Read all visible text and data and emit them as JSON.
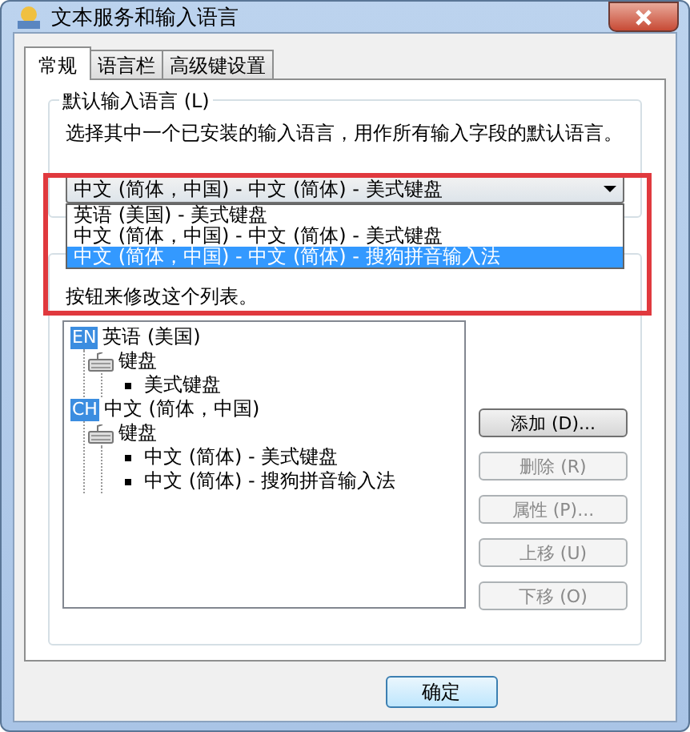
{
  "window": {
    "title": "文本服务和输入语言"
  },
  "tabs": [
    {
      "label": "常规",
      "selected": true
    },
    {
      "label": "语言栏",
      "selected": false
    },
    {
      "label": "高级键设置",
      "selected": false
    }
  ],
  "default_language": {
    "legend": "默认输入语言 (L)",
    "description": "选择其中一个已安装的输入语言，用作所有输入字段的默认语言。",
    "combo_value": "中文 (简体，中国) - 中文 (简体) - 美式键盘",
    "options": [
      {
        "label": "英语 (美国) - 美式键盘",
        "selected": false
      },
      {
        "label": "中文 (简体，中国) - 中文 (简体) - 美式键盘",
        "selected": false
      },
      {
        "label": "中文 (简体，中国) - 中文 (简体) - 搜狗拼音输入法",
        "selected": true
      }
    ]
  },
  "installed_services": {
    "description": "按钮来修改这个列表。",
    "tree": [
      {
        "badge": "EN",
        "label": "英语 (美国)",
        "children": [
          {
            "label": "键盘",
            "children": [
              {
                "label": "美式键盘"
              }
            ]
          }
        ]
      },
      {
        "badge": "CH",
        "label": "中文 (简体，中国)",
        "children": [
          {
            "label": "键盘",
            "children": [
              {
                "label": "中文 (简体) - 美式键盘"
              },
              {
                "label": "中文 (简体) - 搜狗拼音输入法"
              }
            ]
          }
        ]
      }
    ],
    "buttons": [
      {
        "label": "添加 (D)...",
        "disabled": false
      },
      {
        "label": "删除 (R)",
        "disabled": true
      },
      {
        "label": "属性 (P)...",
        "disabled": true
      },
      {
        "label": "上移 (U)",
        "disabled": true
      },
      {
        "label": "下移 (O)",
        "disabled": true
      }
    ]
  },
  "footer_buttons": [
    {
      "label": "确定"
    }
  ]
}
